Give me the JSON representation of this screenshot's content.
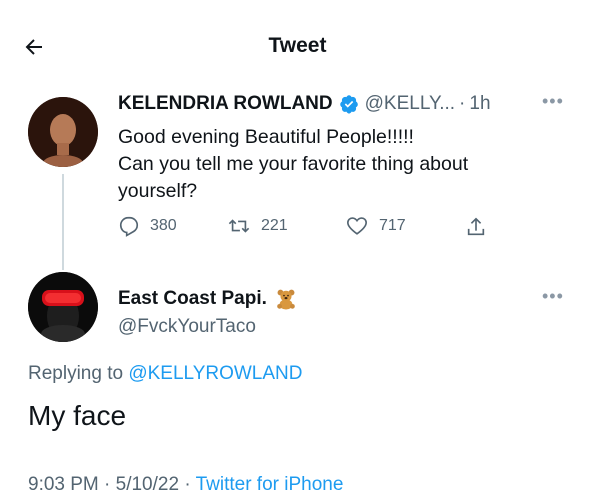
{
  "header": {
    "title": "Tweet"
  },
  "original_tweet": {
    "display_name": "KELENDRIA ROWLAND",
    "handle": "@KELLY...",
    "separator": "·",
    "time": "1h",
    "text_lines": [
      "Good evening Beautiful People!!!!!",
      "Can you tell me your favorite thing about",
      "yourself?"
    ],
    "counts": {
      "replies": "380",
      "retweets": "221",
      "likes": "717"
    }
  },
  "reply_tweet": {
    "display_name": "East Coast Papi.",
    "handle": "@FvckYourTaco",
    "replying_prefix": "Replying to",
    "replying_mention": "@KELLYROWLAND",
    "text": "My face",
    "timestamp": "9:03 PM · 5/10/22 · ",
    "source": "Twitter for iPhone"
  },
  "colors": {
    "accent": "#1d9bf0",
    "secondary_text": "#536471",
    "primary_text": "#0f1419"
  }
}
